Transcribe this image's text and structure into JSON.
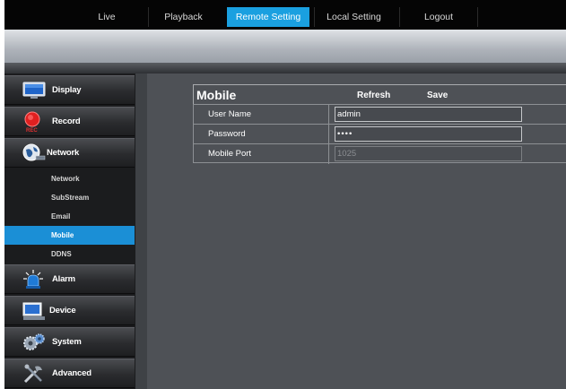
{
  "topnav": {
    "tabs": [
      {
        "label": "Live"
      },
      {
        "label": "Playback"
      },
      {
        "label": "Remote Setting",
        "active": true
      },
      {
        "label": "Local Setting"
      },
      {
        "label": "Logout"
      }
    ]
  },
  "sidebar": {
    "items": [
      {
        "label": "Display",
        "icon": "monitor-icon"
      },
      {
        "label": "Record",
        "icon": "record-icon"
      },
      {
        "label": "Network",
        "icon": "network-globe-icon"
      }
    ],
    "network_subitems": [
      {
        "label": "Network"
      },
      {
        "label": "SubStream"
      },
      {
        "label": "Email"
      },
      {
        "label": "Mobile",
        "active": true
      },
      {
        "label": "DDNS"
      }
    ],
    "items_after": [
      {
        "label": "Alarm",
        "icon": "alarm-siren-icon"
      },
      {
        "label": "Device",
        "icon": "device-icon"
      },
      {
        "label": "System",
        "icon": "system-gears-icon"
      },
      {
        "label": "Advanced",
        "icon": "advanced-tools-icon"
      }
    ]
  },
  "form": {
    "title": "Mobile",
    "refresh_label": "Refresh",
    "save_label": "Save",
    "fields": [
      {
        "label": "User Name",
        "value": "admin"
      },
      {
        "label": "Password",
        "value": "••••"
      },
      {
        "label": "Mobile Port",
        "value": "1025",
        "disabled": true
      }
    ]
  },
  "colors": {
    "accent": "#1aa0e0",
    "active_submenu": "#1b8fd6",
    "panel": "#4e5156",
    "sidebar": "#1b1c1e"
  }
}
